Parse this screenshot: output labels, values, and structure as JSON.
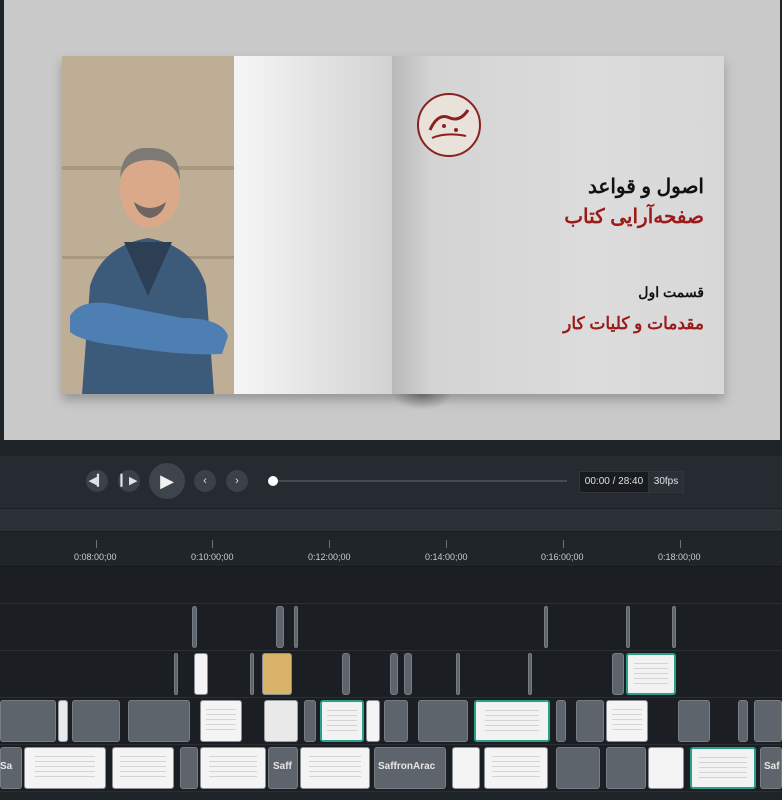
{
  "preview": {
    "title_line1": "اصول و قواعد",
    "title_line2": "صفحه‌آرایی کتاب",
    "subtitle_line1": "قسمت اول",
    "subtitle_line2": "مقدمات و کلیات کار",
    "logo_icon": "calligraphy-seal-icon"
  },
  "player": {
    "prev_frame_icon": "step-back-icon",
    "next_frame_icon": "step-forward-icon",
    "play_icon": "play-icon",
    "prev_marker_icon": "chevron-left-icon",
    "next_marker_icon": "chevron-right-icon",
    "time": "00:00 / 28:40",
    "fps": "30fps",
    "progress": 0
  },
  "ruler": {
    "ticks": [
      "0:08:00;00",
      "0:10:00;00",
      "0:12:00;00",
      "0:14:00;00",
      "0:16:00;00",
      "0:18:00;00"
    ]
  },
  "tracks": {
    "clip_labels": [
      "Sa",
      "Saff",
      "SaffronArac",
      "Saf"
    ]
  },
  "colors": {
    "accent_title": "#9b1b1b",
    "clip_border_green": "#2aa088"
  }
}
